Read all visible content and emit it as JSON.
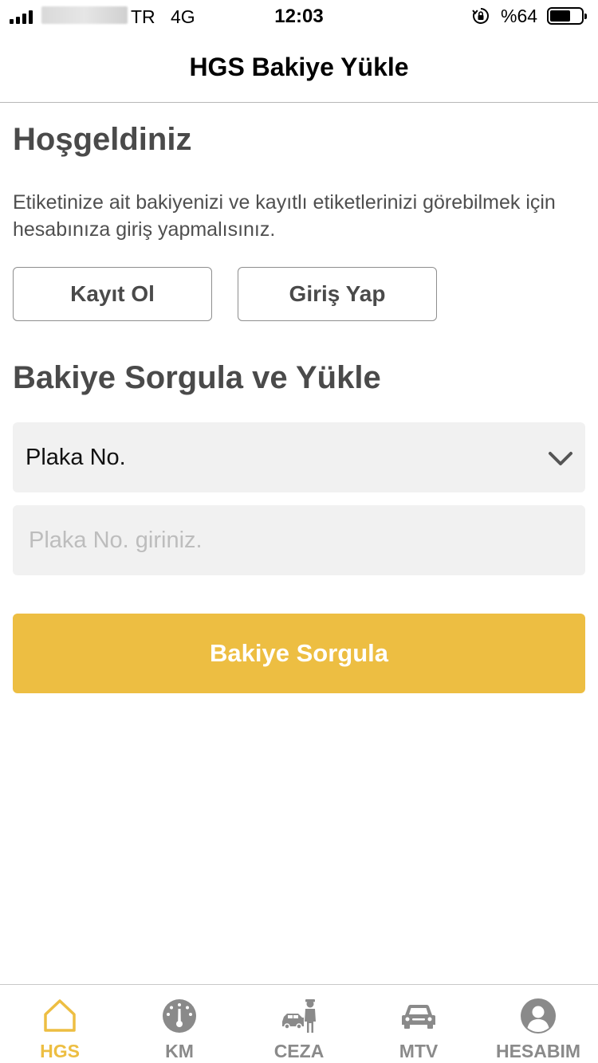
{
  "status_bar": {
    "carrier": "TR",
    "network": "4G",
    "time": "12:03",
    "battery": "%64"
  },
  "nav": {
    "title": "HGS Bakiye Yükle"
  },
  "welcome": {
    "title": "Hoşgeldiniz",
    "text": "Etiketinize ait bakiyenizi ve kayıtlı etiketlerinizi görebilmek için hesabınıza giriş yapmalısınız.",
    "register_label": "Kayıt Ol",
    "login_label": "Giriş Yap"
  },
  "balance": {
    "title": "Bakiye Sorgula ve Yükle",
    "select_value": "Plaka No.",
    "input_placeholder": "Plaka No. giriniz.",
    "submit_label": "Bakiye Sorgula"
  },
  "tabs": [
    {
      "label": "HGS",
      "icon": "home-icon",
      "active": true
    },
    {
      "label": "KM",
      "icon": "gauge-icon",
      "active": false
    },
    {
      "label": "CEZA",
      "icon": "police-car-icon",
      "active": false
    },
    {
      "label": "MTV",
      "icon": "car-icon",
      "active": false
    },
    {
      "label": "HESABIM",
      "icon": "user-icon",
      "active": false
    }
  ],
  "colors": {
    "accent": "#edbe42",
    "tab_inactive": "#8a8a8a",
    "input_bg": "#f1f1f1",
    "heading": "#4a4a4a"
  }
}
